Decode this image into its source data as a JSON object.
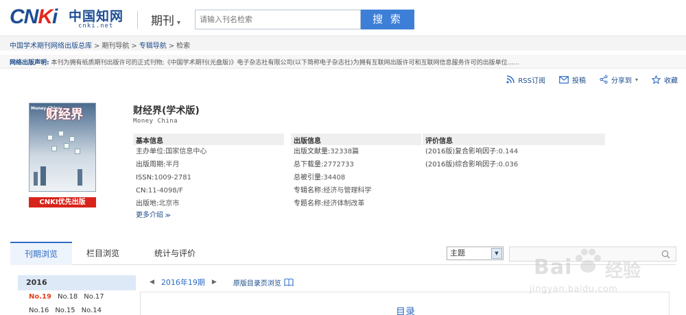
{
  "header": {
    "logo_main": "CNKI",
    "logo_cn": "中国知网",
    "logo_url": "cnki.net",
    "channel": "期刊",
    "search_placeholder": "请输入刊名检索",
    "search_button": "搜 索"
  },
  "breadcrumb": {
    "items": [
      "中国学术期刊网络出版总库",
      "期刊导航",
      "专辑导航",
      "检索"
    ],
    "separator": ">"
  },
  "notice": {
    "label": "网络出版声明:",
    "text": "本刊为拥有纸质期刊出版许可的正式刊物;《中国学术期刊(光盘版)》电子杂志社有限公司(以下简称电子杂志社)为拥有互联网出版许可和互联网信息服务许可的出版单位......"
  },
  "actions": {
    "rss": "RSS订阅",
    "submit": "投稿",
    "share": "分享到",
    "favorite": "收藏"
  },
  "cover": {
    "title": "财经界",
    "en": "Money China",
    "badge": "CNKI优先出版"
  },
  "journal": {
    "title": "财经界(学术版)",
    "en_title": "Money China",
    "basic": {
      "heading": "基本信息",
      "rows": [
        {
          "label": "主办单位:",
          "value": "国家信息中心"
        },
        {
          "label": "出版周期:",
          "value": "半月"
        },
        {
          "label": "ISSN:",
          "value": "1009-2781"
        },
        {
          "label": "CN:",
          "value": "11-4098/F"
        },
        {
          "label": "出版地:",
          "value": "北京市"
        }
      ],
      "more": "更多介绍"
    },
    "publish": {
      "heading": "出版信息",
      "rows": [
        {
          "label": "出版文献量:",
          "value": "32338篇"
        },
        {
          "label": "总下载量:",
          "value": "2772733"
        },
        {
          "label": "总被引量:",
          "value": "34408"
        },
        {
          "label": "专辑名称:",
          "value": "经济与管理科学"
        },
        {
          "label": "专题名称:",
          "value": "经济体制改革"
        }
      ]
    },
    "evaluation": {
      "heading": "评价信息",
      "rows": [
        {
          "label": "(2016版)复合影响因子:",
          "value": "0.144"
        },
        {
          "label": "(2016版)综合影响因子:",
          "value": "0.036"
        }
      ]
    }
  },
  "tabs": [
    {
      "label": "刊期浏览",
      "active": true
    },
    {
      "label": "栏目浏览",
      "active": false
    },
    {
      "label": "统计与评价",
      "active": false
    }
  ],
  "filter": {
    "select_value": "主题"
  },
  "sidebar": {
    "year": "2016",
    "issues": [
      [
        "No.19",
        "No.18",
        "No.17"
      ],
      [
        "No.16",
        "No.15",
        "No.14"
      ]
    ],
    "current": "No.19"
  },
  "content": {
    "current_issue": "2016年19期",
    "original_toc": "原版目录页浏览",
    "toc_title": "目录"
  },
  "watermark": {
    "brand": "Bai",
    "brand_cn": "经验",
    "url": "jingyan.baidu.com"
  },
  "colors": {
    "brand_blue": "#1c4d95",
    "brand_red": "#e4281d",
    "link_blue": "#2d6bc4",
    "search_button": "#3d7fd7",
    "badge_red": "#d8231a",
    "current_issue": "#e0421e"
  }
}
